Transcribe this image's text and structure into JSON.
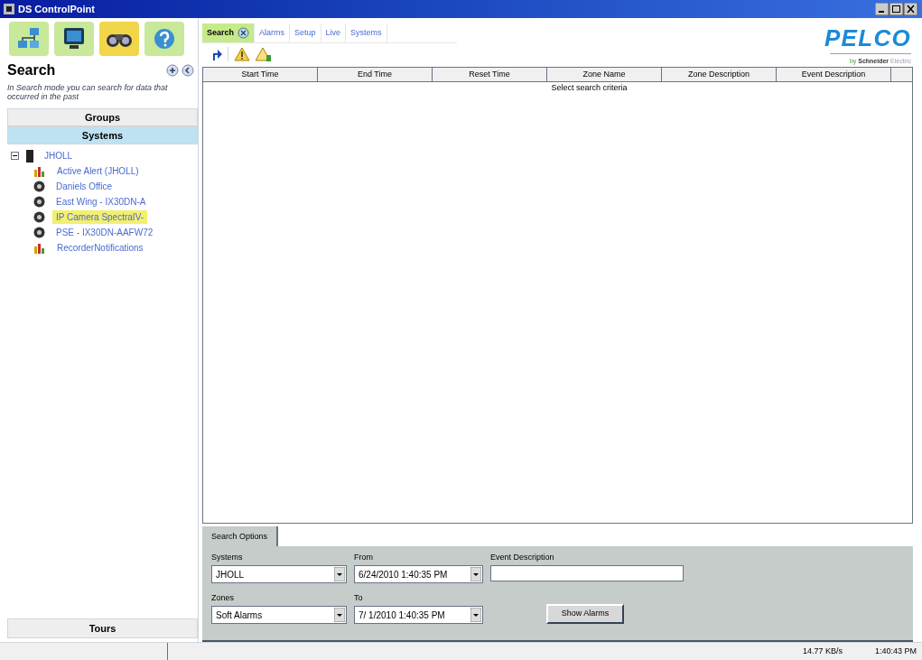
{
  "window": {
    "title": "DS ControlPoint"
  },
  "sidebar": {
    "modes": [
      {
        "kind": "network",
        "selected": false
      },
      {
        "kind": "monitor",
        "selected": false
      },
      {
        "kind": "binoculars",
        "selected": true
      },
      {
        "kind": "help",
        "selected": false
      }
    ],
    "title": "Search",
    "description": "In Search mode you can search for data that occurred in the past",
    "sections": [
      {
        "label": "Groups",
        "selected": false
      },
      {
        "label": "Systems",
        "selected": true
      }
    ],
    "tree": [
      {
        "label": "JHOLL",
        "kind": "server",
        "expanded": true,
        "selected": false,
        "children": [
          {
            "label": "Active Alert (JHOLL)",
            "kind": "alert",
            "selected": false
          },
          {
            "label": "Daniels Office",
            "kind": "camera",
            "selected": false
          },
          {
            "label": "East Wing - IX30DN-A",
            "kind": "camera",
            "selected": false
          },
          {
            "label": "IP Camera SpectraIV-",
            "kind": "camera",
            "selected": true
          },
          {
            "label": "PSE - IX30DN-AAFW72",
            "kind": "camera",
            "selected": false
          },
          {
            "label": "RecorderNotifications",
            "kind": "alert",
            "selected": false
          }
        ]
      }
    ],
    "tours": "Tours"
  },
  "tabs": [
    {
      "label": "Search",
      "selected": true,
      "closable": true
    },
    {
      "label": "Alarms",
      "selected": false,
      "closable": false
    },
    {
      "label": "Setup",
      "selected": false,
      "closable": false
    },
    {
      "label": "Live",
      "selected": false,
      "closable": false
    },
    {
      "label": "Systems",
      "selected": false,
      "closable": false
    }
  ],
  "logo": {
    "brand": "PELCO",
    "by": "by",
    "company": "Schneider",
    "suffix": "Electric"
  },
  "table": {
    "columns": [
      "Start Time",
      "End Time",
      "Reset Time",
      "Zone Name",
      "Zone Description",
      "Event Description"
    ],
    "empty_message": "Select search criteria"
  },
  "search_options": {
    "tab": "Search Options",
    "systems": {
      "label": "Systems",
      "value": "JHOLL"
    },
    "from": {
      "label": "From",
      "value": "6/24/2010  1:40:35 PM"
    },
    "event_description": {
      "label": "Event Description"
    },
    "zones": {
      "label": "Zones",
      "value": "Soft Alarms"
    },
    "to": {
      "label": "To",
      "value": "7/ 1/2010  1:40:35 PM"
    },
    "button": "Show Alarms"
  },
  "status_bar": {
    "rate": "14.77 KB/s",
    "time": "1:40:43 PM"
  }
}
